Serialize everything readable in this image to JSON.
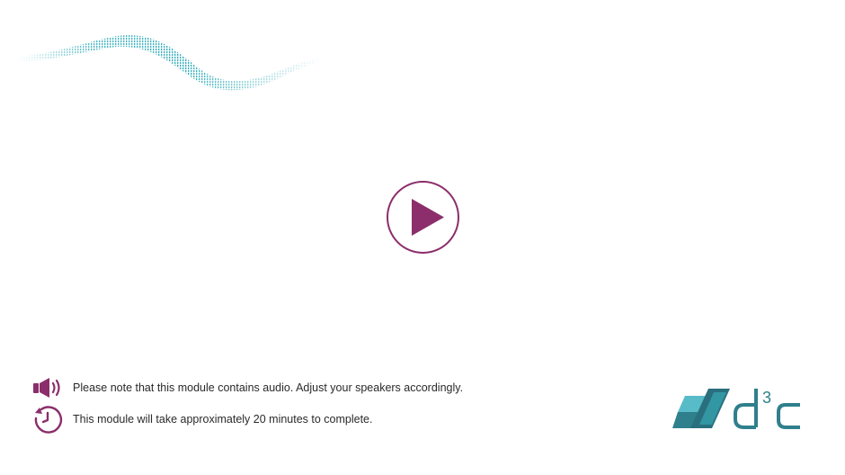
{
  "player": {
    "play_button_icon": "play-icon",
    "accent_color": "#8b2e6b"
  },
  "notices": {
    "audio": {
      "icon": "speaker-icon",
      "text": "Please note that this module contains audio. Adjust your speakers accordingly."
    },
    "duration": {
      "icon": "timer-icon",
      "text": "This module will take approximately 20 minutes to complete."
    }
  },
  "branding": {
    "logo_text": "d³c",
    "logo_color": "#2f7f8c",
    "wave_color": "#3ab0bd"
  }
}
